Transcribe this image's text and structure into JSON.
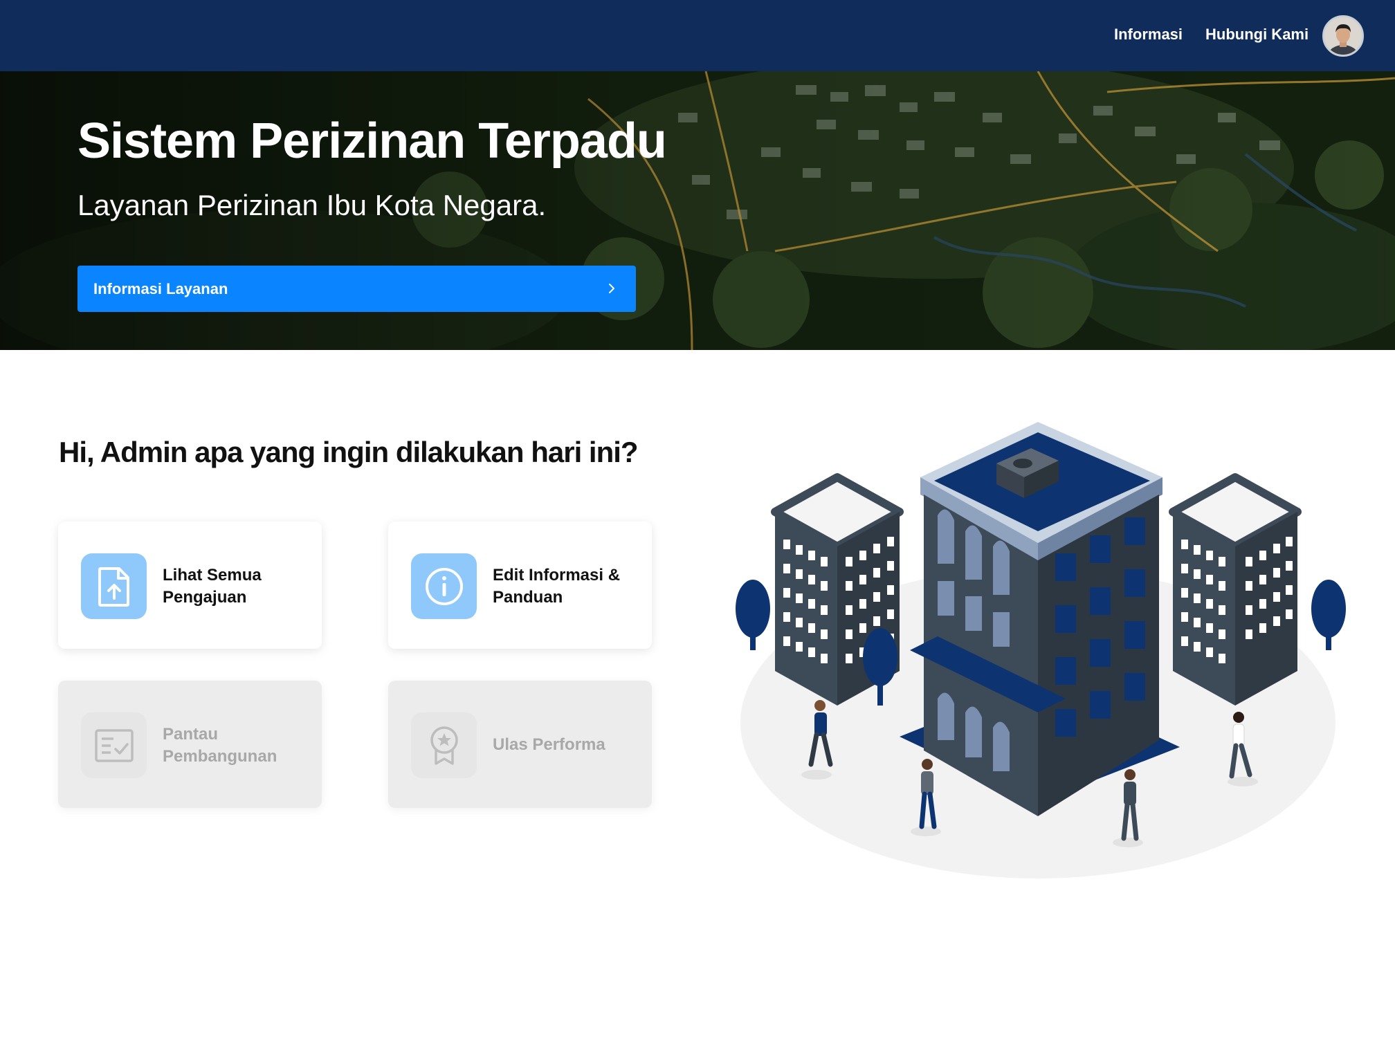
{
  "nav": {
    "links": [
      "Informasi",
      "Hubungi Kami"
    ],
    "avatar_icon": "user-avatar"
  },
  "hero": {
    "title": "Sistem Perizinan Terpadu",
    "subtitle": "Layanan Perizinan Ibu Kota Negara.",
    "button_label": "Informasi Layanan",
    "button_icon": "chevron-right-icon",
    "button_color": "#0a84ff"
  },
  "greeting": "Hi, Admin apa yang ingin dilakukan hari ini?",
  "cards": [
    {
      "label": "Lihat Semua Pengajuan",
      "icon": "file-upload-icon",
      "enabled": true
    },
    {
      "label": "Edit Informasi & Panduan",
      "icon": "info-icon",
      "enabled": true
    },
    {
      "label": "Pantau Pembangunan",
      "icon": "checklist-icon",
      "enabled": false
    },
    {
      "label": "Ulas Performa",
      "icon": "award-badge-icon",
      "enabled": false
    }
  ],
  "colors": {
    "navbar": "#0f2c5b",
    "accent": "#0a84ff",
    "icon_bg": "#8fc8fb",
    "building_blue": "#0d3470",
    "building_gray": "#3d4a57"
  }
}
